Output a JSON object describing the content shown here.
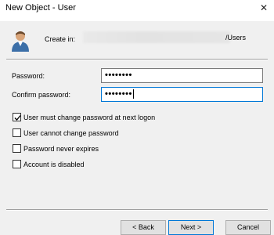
{
  "window": {
    "title": "New Object - User",
    "close_glyph": "✕"
  },
  "header": {
    "icon": "user-icon",
    "create_in_label": "Create in:",
    "create_in_path_tail": "/Users"
  },
  "form": {
    "password_label": "Password:",
    "password_value": "••••••••",
    "confirm_label": "Confirm password:",
    "confirm_value": "••••••••"
  },
  "options": [
    {
      "label": "User must change password at next logon",
      "checked": true
    },
    {
      "label": "User cannot change password",
      "checked": false
    },
    {
      "label": "Password never expires",
      "checked": false
    },
    {
      "label": "Account is disabled",
      "checked": false
    }
  ],
  "buttons": {
    "back": "< Back",
    "next": "Next >",
    "cancel": "Cancel"
  }
}
